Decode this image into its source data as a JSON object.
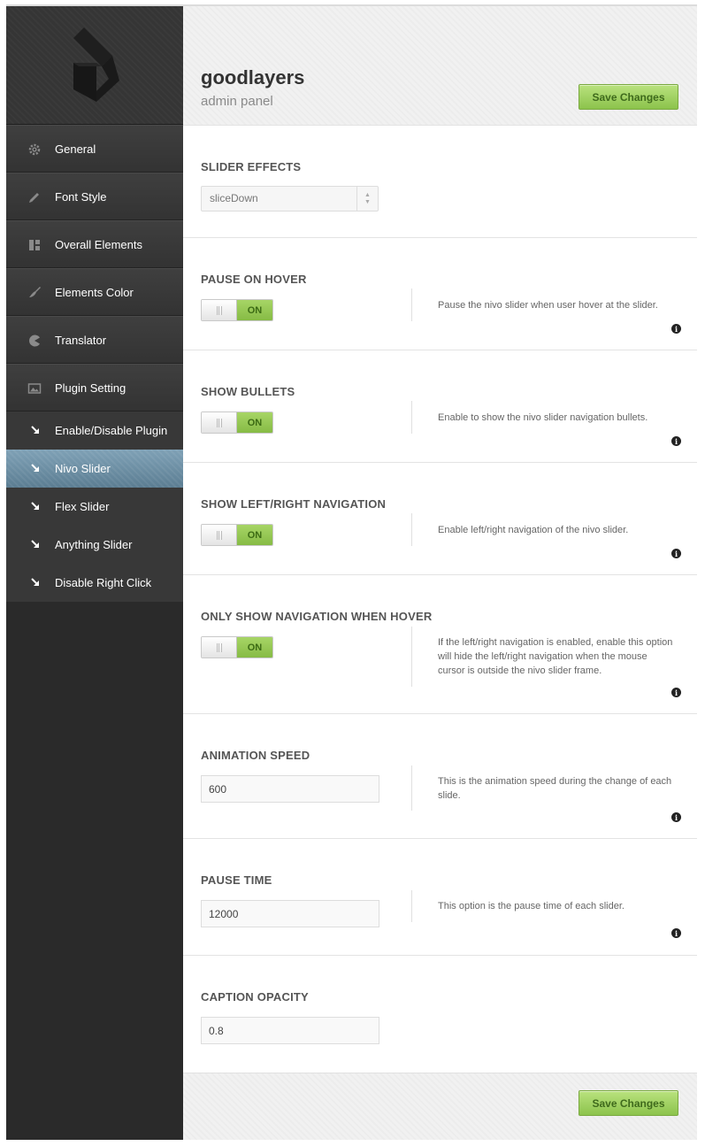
{
  "brand": {
    "title": "goodlayers",
    "subtitle": "admin panel"
  },
  "actions": {
    "save_label": "Save Changes"
  },
  "sidebar": {
    "items": [
      {
        "label": "General",
        "icon": "gear-icon"
      },
      {
        "label": "Font Style",
        "icon": "pencil-icon"
      },
      {
        "label": "Overall Elements",
        "icon": "layout-icon"
      },
      {
        "label": "Elements Color",
        "icon": "brush-icon"
      },
      {
        "label": "Translator",
        "icon": "pacman-icon"
      },
      {
        "label": "Plugin Setting",
        "icon": "image-icon"
      }
    ],
    "subitems": [
      {
        "label": "Enable/Disable Plugin",
        "icon": "arrow-down-right-icon",
        "active": false
      },
      {
        "label": "Nivo Slider",
        "icon": "arrow-down-right-icon",
        "active": true
      },
      {
        "label": "Flex Slider",
        "icon": "arrow-down-right-icon",
        "active": false
      },
      {
        "label": "Anything Slider",
        "icon": "arrow-down-right-icon",
        "active": false
      },
      {
        "label": "Disable Right Click",
        "icon": "arrow-down-right-icon",
        "active": false
      }
    ]
  },
  "sections": {
    "slider_effects": {
      "title": "SLIDER EFFECTS",
      "value": "sliceDown"
    },
    "pause_on_hover": {
      "title": "PAUSE ON HOVER",
      "toggle": "ON",
      "desc": "Pause the nivo slider when user hover at the slider."
    },
    "show_bullets": {
      "title": "SHOW BULLETS",
      "toggle": "ON",
      "desc": "Enable to show the nivo slider navigation bullets."
    },
    "show_nav": {
      "title": "SHOW LEFT/RIGHT NAVIGATION",
      "toggle": "ON",
      "desc": "Enable left/right navigation of the nivo slider."
    },
    "nav_hover": {
      "title": "ONLY SHOW NAVIGATION WHEN HOVER",
      "toggle": "ON",
      "desc": "If the left/right navigation is enabled, enable this option will hide the left/right navigation when the mouse cursor is outside the nivo slider frame."
    },
    "animation_speed": {
      "title": "ANIMATION SPEED",
      "value": "600",
      "desc": "This is the animation speed during the change of each slide."
    },
    "pause_time": {
      "title": "PAUSE TIME",
      "value": "12000",
      "desc": "This option is the pause time of each slider."
    },
    "caption_opacity": {
      "title": "CAPTION OPACITY",
      "value": "0.8"
    }
  },
  "info_glyph": "i"
}
